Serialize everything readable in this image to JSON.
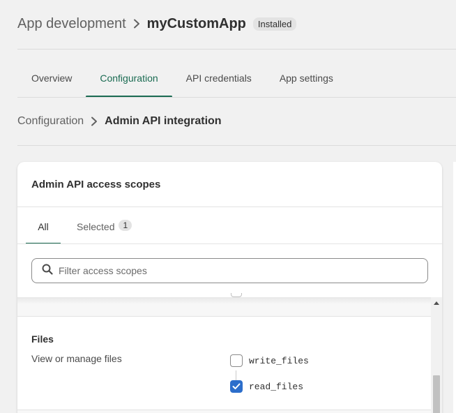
{
  "header": {
    "breadcrumb_parent": "App development",
    "app_name": "myCustomApp",
    "status_badge": "Installed"
  },
  "tabs": [
    {
      "label": "Overview",
      "active": false
    },
    {
      "label": "Configuration",
      "active": true
    },
    {
      "label": "API credentials",
      "active": false
    },
    {
      "label": "App settings",
      "active": false
    }
  ],
  "sub_breadcrumb": {
    "parent": "Configuration",
    "current": "Admin API integration"
  },
  "card": {
    "title": "Admin API access scopes",
    "tabs": {
      "all": "All",
      "selected": "Selected",
      "selected_count": "1"
    },
    "search": {
      "placeholder": "Filter access scopes",
      "value": ""
    },
    "sections": [
      {
        "title": "Files",
        "description": "View or manage files",
        "scopes": [
          {
            "name": "write_files",
            "checked": false
          },
          {
            "name": "read_files",
            "checked": true
          }
        ]
      }
    ]
  },
  "colors": {
    "accent": "#1a6b52",
    "checkbox": "#2c6ecb"
  }
}
